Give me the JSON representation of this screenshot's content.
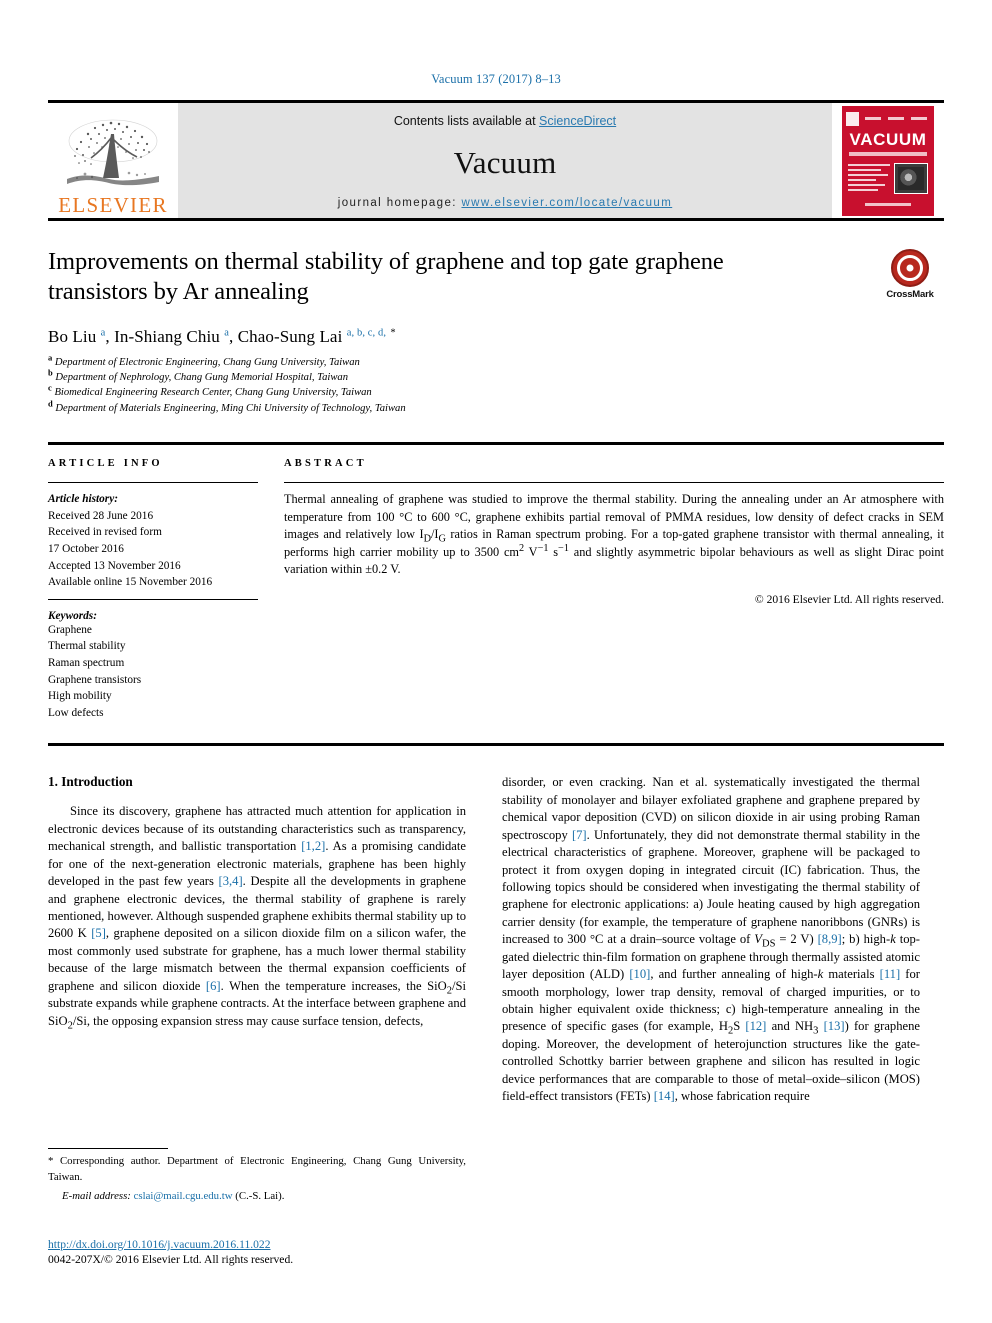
{
  "journal_ref": "Vacuum 137 (2017) 8–13",
  "masthead": {
    "contents_prefix": "Contents lists available at ",
    "contents_link": "ScienceDirect",
    "journal_name": "Vacuum",
    "homepage_prefix": "journal homepage: ",
    "homepage_url": "www.elsevier.com/locate/vacuum",
    "publisher_wordmark": "ELSEVIER",
    "cover_title": "VACUUM"
  },
  "crossmark": {
    "label": "CrossMark"
  },
  "title": "Improvements on thermal stability of graphene and top gate graphene transistors by Ar annealing",
  "authors_html": "Bo Liu <sup>a</sup>, In-Shiang Chiu <sup>a</sup>, Chao-Sung Lai <sup>a, b, c, d,</sup> <sup class=\"star\">*</sup>",
  "affiliations": [
    {
      "marker": "a",
      "text": "Department of Electronic Engineering, Chang Gung University, Taiwan"
    },
    {
      "marker": "b",
      "text": "Department of Nephrology, Chang Gung Memorial Hospital, Taiwan"
    },
    {
      "marker": "c",
      "text": "Biomedical Engineering Research Center, Chang Gung University, Taiwan"
    },
    {
      "marker": "d",
      "text": "Department of Materials Engineering, Ming Chi University of Technology, Taiwan"
    }
  ],
  "article_info": {
    "heading": "ARTICLE INFO",
    "history_label": "Article history:",
    "history": [
      "Received 28 June 2016",
      "Received in revised form",
      "17 October 2016",
      "Accepted 13 November 2016",
      "Available online 15 November 2016"
    ],
    "keywords_label": "Keywords:",
    "keywords": [
      "Graphene",
      "Thermal stability",
      "Raman spectrum",
      "Graphene transistors",
      "High mobility",
      "Low defects"
    ]
  },
  "abstract": {
    "heading": "ABSTRACT",
    "body_html": "Thermal annealing of graphene was studied to improve the thermal stability. During the annealing under an Ar atmosphere with temperature from 100 &deg;C to 600 &deg;C, graphene exhibits partial removal of PMMA residues, low density of defect cracks in SEM images and relatively low I<sub>D</sub>/I<sub>G</sub> ratios in Raman spectrum probing. For a top-gated graphene transistor with thermal annealing, it performs high carrier mobility up to 3500 cm<sup>2</sup> V<sup>−1</sup> s<sup>−1</sup> and slightly asymmetric bipolar behaviours as well as slight Dirac point variation within &plusmn;0.2 V.",
    "copyright": "© 2016 Elsevier Ltd. All rights reserved."
  },
  "body": {
    "section_number_title": "1. Introduction",
    "left_paragraph_html": "Since its discovery, graphene has attracted much attention for application in electronic devices because of its outstanding characteristics such as transparency, mechanical strength, and ballistic transportation <span class=\"ref\">[1,2]</span>. As a promising candidate for one of the next-generation electronic materials, graphene has been highly developed in the past few years <span class=\"ref\">[3,4]</span>. Despite all the developments in graphene and graphene electronic devices, the thermal stability of graphene is rarely mentioned, however. Although suspended graphene exhibits thermal stability up to 2600 K <span class=\"ref\">[5]</span>, graphene deposited on a silicon dioxide film on a silicon wafer, the most commonly used substrate for graphene, has a much lower thermal stability because of the large mismatch between the thermal expansion coefficients of graphene and silicon dioxide <span class=\"ref\">[6]</span>. When the temperature increases, the SiO<sub>2</sub>/Si substrate expands while graphene contracts. At the interface between graphene and SiO<sub>2</sub>/Si, the opposing expansion stress may cause surface tension, defects,",
    "right_paragraph_html": "disorder, or even cracking. Nan et al. systematically investigated the thermal stability of monolayer and bilayer exfoliated graphene and graphene prepared by chemical vapor deposition (CVD) on silicon dioxide in air using probing Raman spectroscopy <span class=\"ref\">[7]</span>. Unfortunately, they did not demonstrate thermal stability in the electrical characteristics of graphene. Moreover, graphene will be packaged to protect it from oxygen doping in integrated circuit (IC) fabrication. Thus, the following topics should be considered when investigating the thermal stability of graphene for electronic applications: a) Joule heating caused by high aggregation carrier density (for example, the temperature of graphene nanoribbons (GNRs) is increased to 300 &deg;C at a drain&ndash;source voltage of <span class=\"ital\">V</span><sub>DS</sub> = 2 V) <span class=\"ref\">[8,9]</span>; b) high-<span class=\"ital\">k</span> top-gated dielectric thin-film formation on graphene through thermally assisted atomic layer deposition (ALD) <span class=\"ref\">[10]</span>, and further annealing of high-<span class=\"ital\">k</span> materials <span class=\"ref\">[11]</span> for smooth morphology, lower trap density, removal of charged impurities, or to obtain higher equivalent oxide thickness; c) high-temperature annealing in the presence of specific gases (for example, H<sub>2</sub>S <span class=\"ref\">[12]</span> and NH<sub>3</sub> <span class=\"ref\">[13]</span>) for graphene doping. Moreover, the development of heterojunction structures like the gate-controlled Schottky barrier between graphene and silicon has resulted in logic device performances that are comparable to those of metal&ndash;oxide&ndash;silicon (MOS) field-effect transistors (FETs) <span class=\"ref\">[14]</span>, whose fabrication require"
  },
  "footnote": {
    "corresponding_html": "* Corresponding author. Department of Electronic Engineering, Chang Gung University, Taiwan.",
    "email_label": "E-mail address:",
    "email": "cslai@mail.cgu.edu.tw",
    "email_suffix": "(C.-S. Lai).",
    "doi": "http://dx.doi.org/10.1016/j.vacuum.2016.11.022",
    "issn_line": "0042-207X/© 2016 Elsevier Ltd. All rights reserved."
  },
  "colors": {
    "link_blue": "#1a6fa8",
    "elsevier_orange": "#e87722",
    "cover_red": "#c8102e",
    "masthead_gray": "#e3e3e3"
  }
}
